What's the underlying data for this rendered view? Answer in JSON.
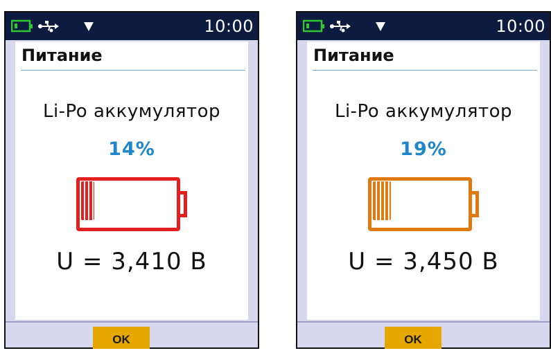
{
  "screens": [
    {
      "status": {
        "time": "10:00",
        "icons": [
          "battery-icon",
          "usb-icon",
          "signal-down-icon"
        ]
      },
      "title": "Питание",
      "battery_type": "Li-Po аккумулятор",
      "percent": "14%",
      "level": 0.14,
      "battery_color": "#e32020",
      "voltage": "U = 3,410 В",
      "ok_label": "OK"
    },
    {
      "status": {
        "time": "10:00",
        "icons": [
          "battery-icon",
          "usb-icon",
          "signal-down-icon"
        ]
      },
      "title": "Питание",
      "battery_type": "Li-Po аккумулятор",
      "percent": "19%",
      "level": 0.19,
      "battery_color": "#e0790f",
      "voltage": "U = 3,450 В",
      "ok_label": "OK"
    }
  ],
  "colors": {
    "statusbar": "#0c1b3f",
    "percent_text": "#1e86c9",
    "status_battery_icon": "#32c832",
    "ok_button": "#e6a700"
  }
}
